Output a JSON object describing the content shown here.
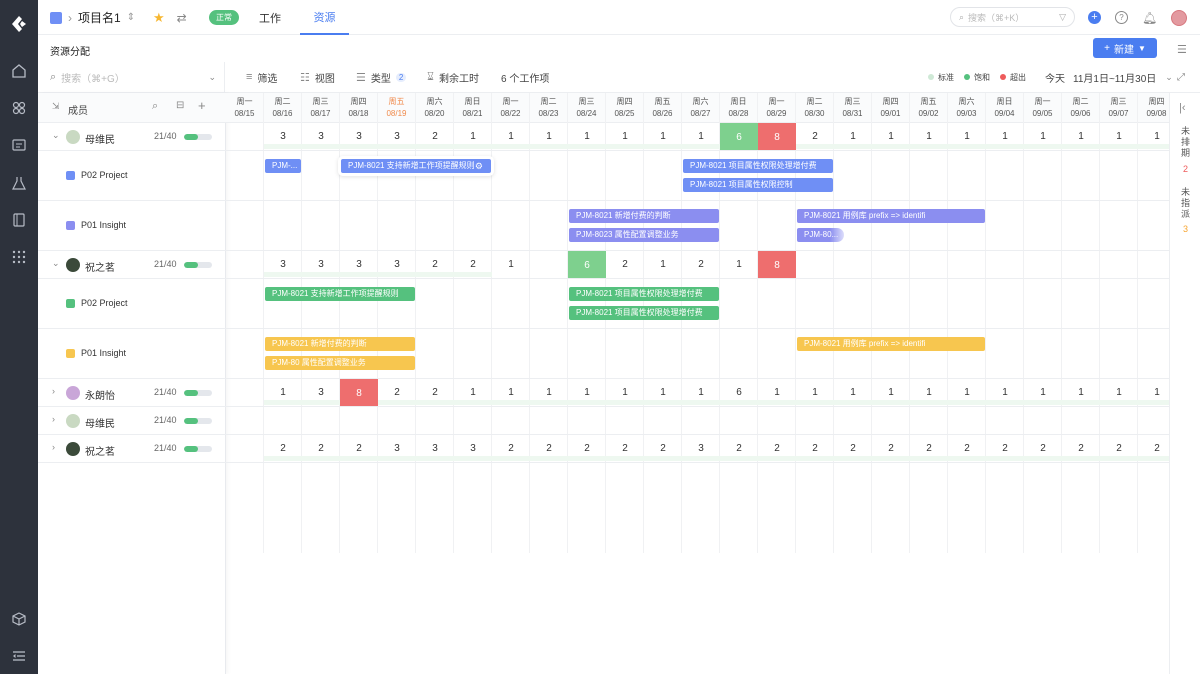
{
  "header": {
    "project_name": "项目名1",
    "status": "正常",
    "tabs": [
      "工作",
      "资源"
    ],
    "search_placeholder": "搜索（⌘+K）"
  },
  "subheader": {
    "title": "资源分配",
    "new_button": "新建"
  },
  "filters": {
    "search_placeholder": "搜索（⌘+G）",
    "filter": "筛选",
    "view": "视图",
    "type": "类型",
    "type_count": "2",
    "remaining": "剩余工时",
    "items": "6 个工作项",
    "legend": [
      "标准",
      "饱和",
      "超出"
    ],
    "today": "今天",
    "range": "11月1日~11月30日"
  },
  "colors": {
    "standard": "#cfe9d6",
    "saturated": "#55c17e",
    "exceeded": "#ee5b5b",
    "green_cell": "#7ed08e",
    "red_cell": "#ee6e6e",
    "blue_bar": "#6f8ff5",
    "purple_bar": "#8b8ef0",
    "green_bar": "#55c17e",
    "yellow_bar": "#f7c64f"
  },
  "members_header": {
    "label": "成员"
  },
  "days": [
    {
      "w": "周一",
      "d": "08/15"
    },
    {
      "w": "周二",
      "d": "08/16"
    },
    {
      "w": "周三",
      "d": "08/17"
    },
    {
      "w": "周四",
      "d": "08/18"
    },
    {
      "w": "周五",
      "d": "08/19",
      "hl": true
    },
    {
      "w": "周六",
      "d": "08/20"
    },
    {
      "w": "周日",
      "d": "08/21"
    },
    {
      "w": "周一",
      "d": "08/22"
    },
    {
      "w": "周二",
      "d": "08/23"
    },
    {
      "w": "周三",
      "d": "08/24"
    },
    {
      "w": "周四",
      "d": "08/25"
    },
    {
      "w": "周五",
      "d": "08/26"
    },
    {
      "w": "周六",
      "d": "08/27"
    },
    {
      "w": "周日",
      "d": "08/28"
    },
    {
      "w": "周一",
      "d": "08/29"
    },
    {
      "w": "周二",
      "d": "08/30"
    },
    {
      "w": "周三",
      "d": "08/31"
    },
    {
      "w": "周四",
      "d": "09/01"
    },
    {
      "w": "周五",
      "d": "09/02"
    },
    {
      "w": "周六",
      "d": "09/03"
    },
    {
      "w": "周日",
      "d": "09/04"
    },
    {
      "w": "周一",
      "d": "09/05"
    },
    {
      "w": "周二",
      "d": "09/06"
    },
    {
      "w": "周三",
      "d": "09/07"
    },
    {
      "w": "周四",
      "d": "09/08"
    }
  ],
  "rows": [
    {
      "kind": "member",
      "name": "母维民",
      "cap": "21/40",
      "fill": 0.5,
      "expanded": true,
      "cells": [
        "",
        "3",
        "3",
        "3",
        "3",
        "2",
        "1",
        "1",
        "1",
        "1",
        "1",
        "1",
        "1",
        "6",
        "8",
        "2",
        "1",
        "1",
        "1",
        "1",
        "1",
        "1",
        "1",
        "1",
        "1"
      ],
      "hot": {
        "13": "green",
        "14": "red"
      },
      "avatar": "#c9d9c2"
    },
    {
      "kind": "project",
      "name": "P02 Project",
      "icon": "#6f8ff5",
      "bars": [
        {
          "label": "PJM-...",
          "c0": 1,
          "c1": 2,
          "color": "#6f8ff5",
          "lane": 0
        },
        {
          "label": "PJM-8021  支持新增工作项提醒规则",
          "c0": 3,
          "c1": 7,
          "color": "#6f8ff5",
          "lane": 0,
          "sel": true
        },
        {
          "label": "PJM-8021  项目属性权限处理增付费",
          "c0": 12,
          "c1": 16,
          "color": "#6f8ff5",
          "lane": 0
        },
        {
          "label": "PJM-8021  项目属性权限控制",
          "c0": 12,
          "c1": 16,
          "color": "#6f8ff5",
          "lane": 1
        }
      ]
    },
    {
      "kind": "project",
      "name": "P01 Insight",
      "icon": "#8b8ef0",
      "bars": [
        {
          "label": "PJM-8021  新增付费的判断",
          "c0": 9,
          "c1": 13,
          "color": "#8b8ef0",
          "lane": 0
        },
        {
          "label": "PJM-8023  属性配置调整业务",
          "c0": 9,
          "c1": 13,
          "color": "#8b8ef0",
          "lane": 1
        },
        {
          "label": "PJM-8021  用例库 prefix => identifi",
          "c0": 15,
          "c1": 20,
          "color": "#8b8ef0",
          "lane": 0
        },
        {
          "label": "PJM-80...",
          "c0": 15,
          "c1": 16.3,
          "color": "#8b8ef0",
          "lane": 1,
          "fade": true
        }
      ]
    },
    {
      "kind": "member",
      "name": "祝之茗",
      "cap": "21/40",
      "fill": 0.5,
      "expanded": true,
      "cells": [
        "",
        "3",
        "3",
        "3",
        "3",
        "2",
        "2",
        "1",
        "",
        "6",
        "2",
        "1",
        "2",
        "1",
        "8",
        "",
        "",
        "",
        "",
        "",
        "",
        "",
        "",
        "",
        ""
      ],
      "hot": {
        "9": "green",
        "14": "red"
      },
      "avatar": "#3b4a3a"
    },
    {
      "kind": "project",
      "name": "P02 Project",
      "icon": "#55c17e",
      "bars": [
        {
          "label": "PJM-8021  支持新增工作项提醒规则",
          "c0": 1,
          "c1": 5,
          "color": "#55c17e",
          "lane": 0
        },
        {
          "label": "PJM-8021  项目属性权限处理增付费",
          "c0": 9,
          "c1": 13,
          "color": "#55c17e",
          "lane": 0
        },
        {
          "label": "PJM-8021  项目属性权限处理增付费",
          "c0": 9,
          "c1": 13,
          "color": "#55c17e",
          "lane": 1
        }
      ]
    },
    {
      "kind": "project",
      "name": "P01 Insight",
      "icon": "#f7c64f",
      "bars": [
        {
          "label": "PJM-8021  新增付费的判断",
          "c0": 1,
          "c1": 5,
          "color": "#f7c64f",
          "lane": 0
        },
        {
          "label": "PJM-80  属性配置调整业务",
          "c0": 1,
          "c1": 5,
          "color": "#f7c64f",
          "lane": 1
        },
        {
          "label": "PJM-8021  用例库 prefix => identifi",
          "c0": 15,
          "c1": 20,
          "color": "#f7c64f",
          "lane": 0
        }
      ]
    },
    {
      "kind": "member",
      "name": "永朗怡",
      "cap": "21/40",
      "fill": 0.5,
      "expanded": false,
      "cells": [
        "",
        "1",
        "3",
        "8",
        "2",
        "2",
        "1",
        "1",
        "1",
        "1",
        "1",
        "1",
        "1",
        "6",
        "1",
        "1",
        "1",
        "1",
        "1",
        "1",
        "1",
        "1",
        "1",
        "1",
        "1"
      ],
      "hot": {
        "3": "red"
      },
      "avatar": "#c9a6d8"
    },
    {
      "kind": "member",
      "name": "母维民",
      "cap": "21/40",
      "fill": 0.5,
      "expanded": false,
      "cells": [],
      "hot": {},
      "avatar": "#c9d9c2"
    },
    {
      "kind": "member",
      "name": "祝之茗",
      "cap": "21/40",
      "fill": 0.5,
      "expanded": false,
      "cells": [
        "",
        "2",
        "2",
        "2",
        "3",
        "3",
        "3",
        "2",
        "2",
        "2",
        "2",
        "2",
        "3",
        "2",
        "2",
        "2",
        "2",
        "2",
        "2",
        "2",
        "2",
        "2",
        "2",
        "2",
        "2"
      ],
      "hot": {},
      "avatar": "#3b4a3a"
    }
  ],
  "right_panel": {
    "unscheduled": "未排期",
    "unscheduled_count": "2",
    "unassigned": "未指派",
    "unassigned_count": "3"
  }
}
